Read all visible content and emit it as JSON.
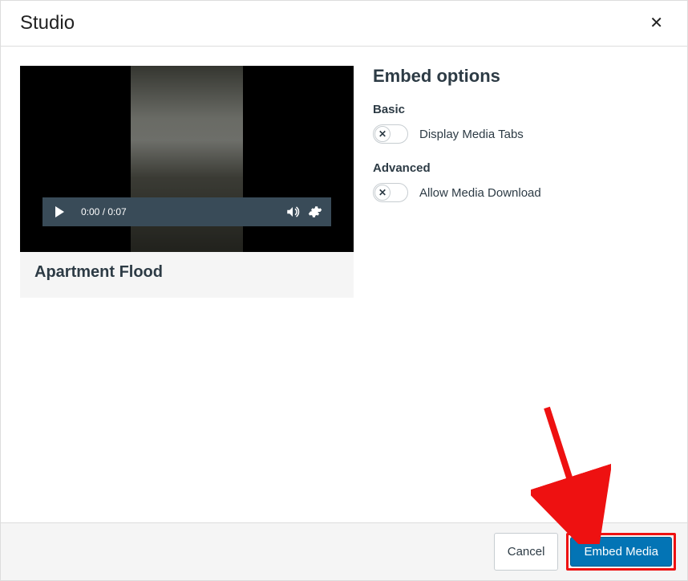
{
  "header": {
    "title": "Studio"
  },
  "video": {
    "time": "0:00 / 0:07",
    "title": "Apartment Flood"
  },
  "options": {
    "title": "Embed options",
    "basic": {
      "label": "Basic",
      "display_tabs_label": "Display Media Tabs"
    },
    "advanced": {
      "label": "Advanced",
      "allow_download_label": "Allow Media Download"
    }
  },
  "footer": {
    "cancel": "Cancel",
    "embed": "Embed Media"
  }
}
